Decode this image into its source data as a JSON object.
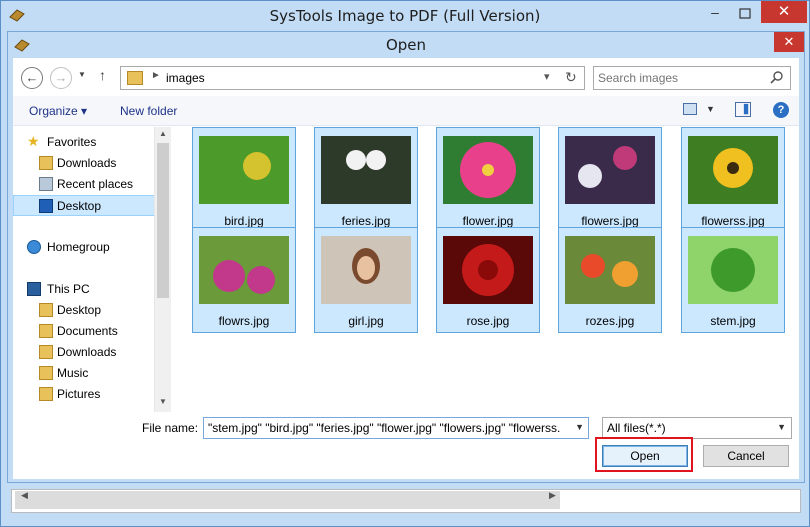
{
  "app": {
    "title": "SysTools Image to PDF (Full Version)",
    "minimize": "–",
    "close": "✕"
  },
  "dialog": {
    "title": "Open",
    "close": "✕"
  },
  "address": {
    "path": "images",
    "separator": "►"
  },
  "search": {
    "placeholder": "Search images"
  },
  "toolbar": {
    "organize_label": "Organize ▾",
    "new_folder_label": "New folder"
  },
  "nav": {
    "items": [
      {
        "label": "Favorites",
        "icon": "star-icon"
      },
      {
        "label": "Downloads",
        "icon": "folder-icon"
      },
      {
        "label": "Recent places",
        "icon": "recent-places-icon"
      },
      {
        "label": "Desktop",
        "icon": "desktop-icon",
        "selected": true
      },
      {
        "label": "Homegroup",
        "icon": "homegroup-icon"
      },
      {
        "label": "This PC",
        "icon": "computer-icon"
      },
      {
        "label": "Desktop",
        "icon": "folder-icon"
      },
      {
        "label": "Documents",
        "icon": "folder-icon"
      },
      {
        "label": "Downloads",
        "icon": "folder-icon"
      },
      {
        "label": "Music",
        "icon": "folder-icon"
      },
      {
        "label": "Pictures",
        "icon": "folder-icon"
      }
    ]
  },
  "files": [
    {
      "name": "bird.jpg",
      "colors": [
        "#4c9a2a",
        "#d4c22e"
      ]
    },
    {
      "name": "feries.jpg",
      "colors": [
        "#2d3a2a",
        "#f2f2f2"
      ]
    },
    {
      "name": "flower.jpg",
      "colors": [
        "#2e7d32",
        "#e8408a"
      ]
    },
    {
      "name": "flowers.jpg",
      "colors": [
        "#3b2b4a",
        "#e6e6f0"
      ]
    },
    {
      "name": "flowerss.jpg",
      "colors": [
        "#3e7d22",
        "#f0c020"
      ]
    },
    {
      "name": "flowrs.jpg",
      "colors": [
        "#6a9a3a",
        "#c2388a"
      ]
    },
    {
      "name": "girl.jpg",
      "colors": [
        "#cfc4b8",
        "#7a4a2e"
      ]
    },
    {
      "name": "rose.jpg",
      "colors": [
        "#5a0808",
        "#c41a1a"
      ]
    },
    {
      "name": "rozes.jpg",
      "colors": [
        "#6a8a3a",
        "#e84a2a"
      ]
    },
    {
      "name": "stem.jpg",
      "colors": [
        "#8fd46a",
        "#3e9a2a"
      ]
    }
  ],
  "footer": {
    "file_name_label": "File name:",
    "file_name_value": "\"stem.jpg\" \"bird.jpg\" \"feries.jpg\" \"flower.jpg\" \"flowers.jpg\" \"flowerss.",
    "filter_value": "All files(*.*)",
    "open_label": "Open",
    "cancel_label": "Cancel"
  },
  "colors": {
    "selection_fill": "#cce8ff",
    "selection_border": "#5fa4dc",
    "highlight_red": "#e0141e",
    "close_red": "#c7372f"
  }
}
